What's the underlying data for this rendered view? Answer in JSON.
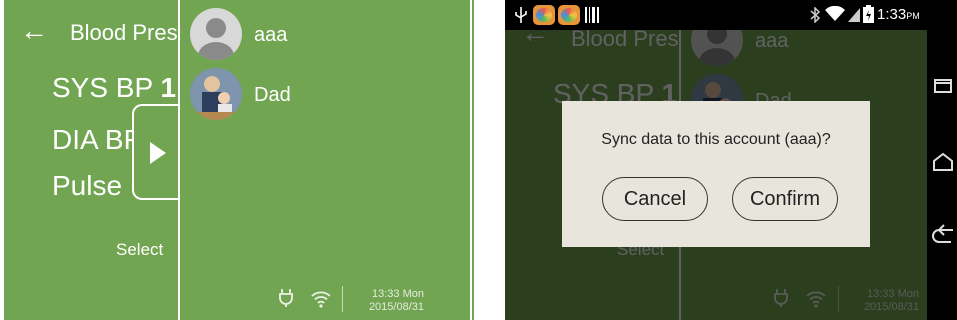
{
  "app": {
    "title": "Blood Pres",
    "readings": {
      "sys_label": "SYS BP",
      "sys_value": "1",
      "dia_label": "DIA BF",
      "pulse_label": "Pulse"
    },
    "select_hint": "Select"
  },
  "drawer": {
    "accounts": [
      {
        "name": "aaa",
        "avatar": "default-person-avatar"
      },
      {
        "name": "Dad",
        "avatar": "photo-avatar"
      }
    ]
  },
  "device_status": {
    "time": "13:33 Mon",
    "date": "2015/08/31",
    "icons": [
      "plug-icon",
      "wifi-icon"
    ]
  },
  "android": {
    "clock": "1:33",
    "clock_suffix": "PM",
    "icons": [
      "usb-icon",
      "app-notification-icon",
      "app-notification-icon",
      "barcode-icon",
      "bluetooth-icon",
      "wifi-icon",
      "signal-icon",
      "battery-icon"
    ],
    "nav": [
      "recent-apps-icon",
      "home-icon",
      "back-icon"
    ]
  },
  "dialog": {
    "message": "Sync data to this account (aaa)?",
    "cancel_label": "Cancel",
    "confirm_label": "Confirm"
  },
  "colors": {
    "app_green": "#72a552",
    "dialog_bg": "#e8e5dc"
  }
}
